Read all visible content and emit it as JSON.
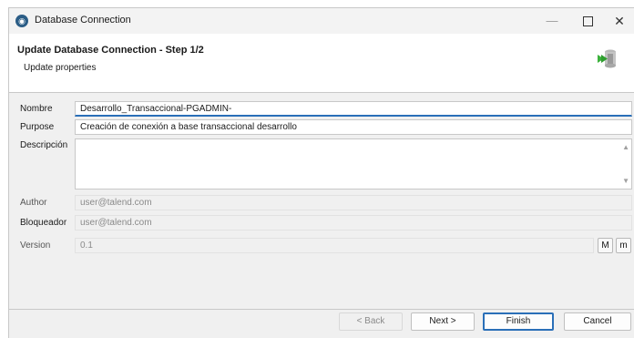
{
  "window": {
    "title": "Database Connection",
    "controls": {
      "minimize": "—",
      "close": "✕"
    }
  },
  "header": {
    "title": "Update Database Connection - Step 1/2",
    "subtitle": "Update properties"
  },
  "form": {
    "nombre": {
      "label": "Nombre",
      "value": "Desarrollo_Transaccional-PGADMIN-"
    },
    "purpose": {
      "label": "Purpose",
      "value": "Creación de conexión a base transaccional desarrollo"
    },
    "descripcion": {
      "label": "Descripción",
      "value": ""
    },
    "author": {
      "label": "Author",
      "value": "user@talend.com"
    },
    "bloqueador": {
      "label": "Bloqueador",
      "value": "user@talend.com"
    },
    "version": {
      "label": "Version",
      "value": "0.1",
      "major_label": "M",
      "minor_label": "m"
    }
  },
  "buttons": {
    "back": "< Back",
    "next": "Next >",
    "finish": "Finish",
    "cancel": "Cancel"
  },
  "icons": {
    "scroll_up": "▲",
    "scroll_down": "▼"
  },
  "colors": {
    "focus": "#2a6fb8",
    "wizard_arrow": "#3cb23c"
  }
}
